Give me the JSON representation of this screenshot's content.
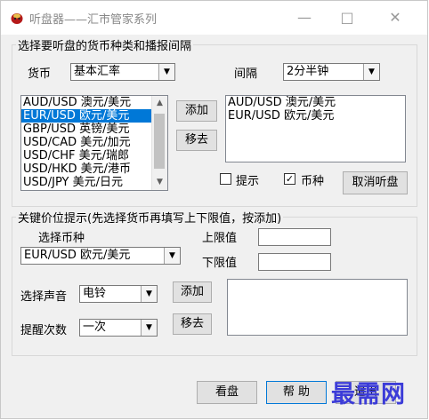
{
  "window": {
    "title": "听盘器——汇市管家系列",
    "controls": {
      "minimize": "—",
      "maximize": "□",
      "close": "✕"
    }
  },
  "group1": {
    "legend": "选择要听盘的货币种类和播报间隔",
    "currency_label": "货币",
    "currency_select": "基本汇率",
    "interval_label": "间隔",
    "interval_select": "2分半钟",
    "available_list": [
      "AUD/USD 澳元/美元",
      "EUR/USD 欧元/美元",
      "GBP/USD 英镑/美元",
      "USD/CAD 美元/加元",
      "USD/CHF 美元/瑞郎",
      "USD/HKD 美元/港币",
      "USD/JPY 美元/日元"
    ],
    "selected_index": 1,
    "add_button": "添加",
    "remove_button": "移去",
    "chosen_list": [
      "AUD/USD 澳元/美元",
      "EUR/USD 欧元/美元"
    ],
    "hint_checkbox": {
      "label": "提示",
      "checked": false
    },
    "currency_checkbox": {
      "label": "币种",
      "checked": true
    },
    "cancel_button": "取消听盘"
  },
  "group2": {
    "legend": "关键价位提示(先选择货币再填写上下限值，按添加)",
    "select_currency_label": "选择币种",
    "currency_select": "EUR/USD 欧元/美元",
    "upper_label": "上限值",
    "lower_label": "下限值",
    "sound_label": "选择声音",
    "sound_select": "电铃",
    "times_label": "提醒次数",
    "times_select": "一次",
    "add_button": "添加",
    "remove_button": "移去"
  },
  "footer": {
    "view_button": "看盘",
    "help_button": "帮 助",
    "exit_button": "退出"
  },
  "watermark": "最需网",
  "colors": {
    "selection": "#0078d7",
    "watermark": "#3c3cd8",
    "window_bg": "#f0f0f0"
  }
}
